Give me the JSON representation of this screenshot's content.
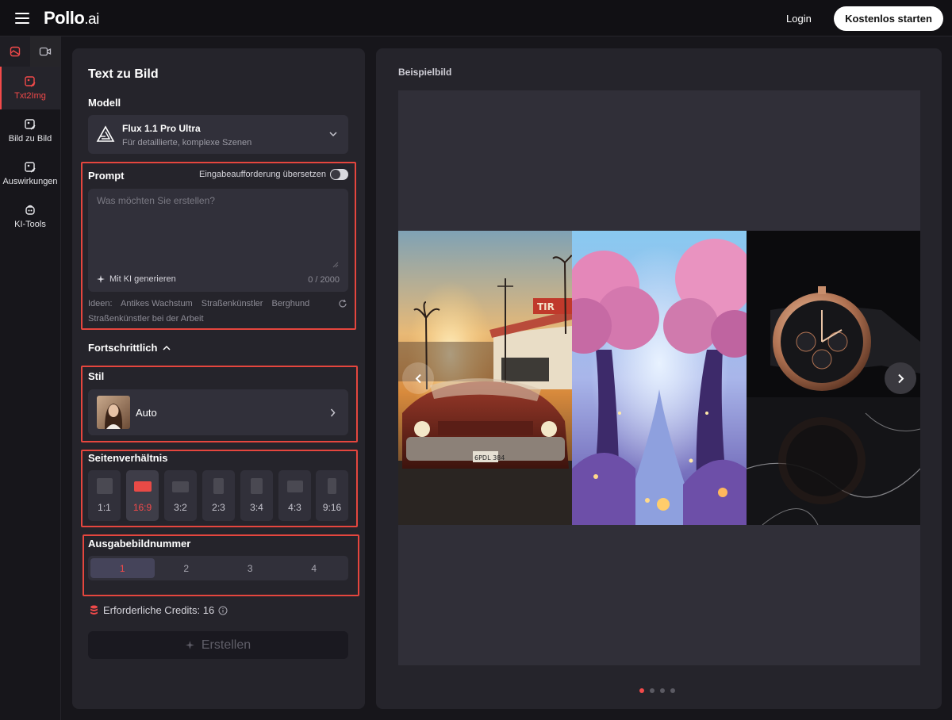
{
  "header": {
    "logo_main": "Pollo",
    "logo_suffix": ".ai",
    "login_label": "Login",
    "start_label": "Kostenlos starten"
  },
  "sidebar": {
    "items": [
      {
        "label": "Txt2Img",
        "icon": "image-pen-icon",
        "active": true
      },
      {
        "label": "Bild zu Bild",
        "icon": "image-transform-icon",
        "active": false
      },
      {
        "label": "Auswirkungen",
        "icon": "effects-icon",
        "active": false
      },
      {
        "label": "KI-Tools",
        "icon": "ai-tools-icon",
        "active": false
      }
    ]
  },
  "form": {
    "title": "Text zu Bild",
    "model_label": "Modell",
    "model_name": "Flux 1.1 Pro Ultra",
    "model_desc": "Für detaillierte, komplexe Szenen",
    "prompt_label": "Prompt",
    "translate_label": "Eingabeaufforderung übersetzen",
    "prompt_placeholder": "Was möchten Sie erstellen?",
    "prompt_value": "",
    "ai_generate_label": "Mit KI generieren",
    "char_count": "0 / 2000",
    "ideas_label": "Ideen:",
    "ideas": [
      "Antikes Wachstum",
      "Straßenkünstler",
      "Berghund",
      "Straßenkünstler bei der Arbeit"
    ],
    "advanced_label": "Fortschrittlich",
    "style_label": "Stil",
    "style_value": "Auto",
    "aspect_label": "Seitenverhältnis",
    "aspects": [
      "1:1",
      "16:9",
      "3:2",
      "2:3",
      "3:4",
      "4:3",
      "9:16"
    ],
    "aspect_selected": "16:9",
    "output_label": "Ausgabebildnummer",
    "output_options": [
      "1",
      "2",
      "3",
      "4"
    ],
    "output_selected": "1",
    "credits_label": "Erforderliche Credits: 16",
    "create_label": "Erstellen"
  },
  "preview": {
    "title": "Beispielbild",
    "plate_text": "6PDL 384",
    "sign_text": "TIR",
    "dots_count": 4,
    "active_dot": 0
  },
  "colors": {
    "accent": "#f34a4a",
    "panel": "#25242b",
    "input": "#31303a"
  }
}
